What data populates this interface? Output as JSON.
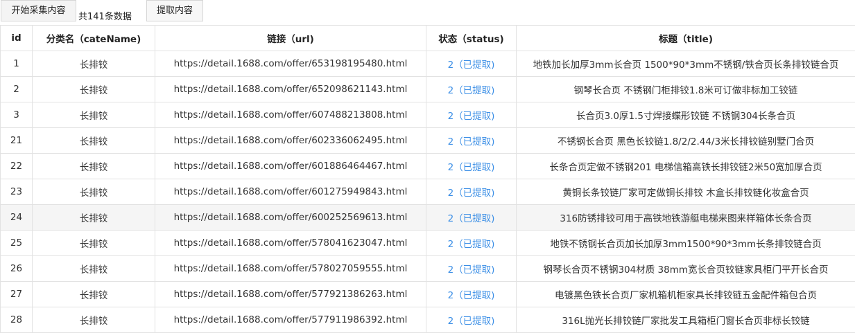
{
  "toolbar": {
    "start_label": "开始采集内容",
    "count_text": "共141条数据",
    "extract_label": "提取内容"
  },
  "table": {
    "headers": [
      "id",
      "分类名（cateName)",
      "链接（url)",
      "状态（status)",
      "标题（title)"
    ],
    "rows": [
      {
        "id": "1",
        "cate": "长排铰",
        "url": "https://detail.1688.com/offer/653198195480.html",
        "status": "2（已提取)",
        "title": "地铁加长加厚3mm长合页 1500*90*3mm不锈钢/铁合页长条排铰链合页"
      },
      {
        "id": "2",
        "cate": "长排铰",
        "url": "https://detail.1688.com/offer/652098621143.html",
        "status": "2（已提取)",
        "title": "钢琴长合页 不锈钢门柜排铰1.8米可订做非标加工铰链"
      },
      {
        "id": "3",
        "cate": "长排铰",
        "url": "https://detail.1688.com/offer/607488213808.html",
        "status": "2（已提取)",
        "title": "长合页3.0厚1.5寸焊接蝶形铰链 不锈钢304长条合页"
      },
      {
        "id": "21",
        "cate": "长排铰",
        "url": "https://detail.1688.com/offer/602336062495.html",
        "status": "2（已提取)",
        "title": "不锈钢长合页 黑色长铰链1.8/2/2.44/3米长排铰链别墅门合页"
      },
      {
        "id": "22",
        "cate": "长排铰",
        "url": "https://detail.1688.com/offer/601886464467.html",
        "status": "2（已提取)",
        "title": "长条合页定做不锈钢201 电梯信箱高铁长排铰链2米50宽加厚合页"
      },
      {
        "id": "23",
        "cate": "长排铰",
        "url": "https://detail.1688.com/offer/601275949843.html",
        "status": "2（已提取)",
        "title": "黄铜长条铰链厂家可定做铜长排铰 木盒长排铰链化妆盒合页"
      },
      {
        "id": "24",
        "cate": "长排铰",
        "url": "https://detail.1688.com/offer/600252569613.html",
        "status": "2（已提取)",
        "title": "316防锈排铰可用于高铁地铁游艇电梯来图来样箱体长条合页"
      },
      {
        "id": "25",
        "cate": "长排铰",
        "url": "https://detail.1688.com/offer/578041623047.html",
        "status": "2（已提取)",
        "title": "地铁不锈钢长合页加长加厚3mm1500*90*3mm长条排铰链合页"
      },
      {
        "id": "26",
        "cate": "长排铰",
        "url": "https://detail.1688.com/offer/578027059555.html",
        "status": "2（已提取)",
        "title": "钢琴长合页不锈钢304材质 38mm宽长合页铰链家具柜门平开长合页"
      },
      {
        "id": "27",
        "cate": "长排铰",
        "url": "https://detail.1688.com/offer/577921386263.html",
        "status": "2（已提取)",
        "title": "电镀黑色铁长合页厂家机箱机柜家具长排铰链五金配件箱包合页"
      },
      {
        "id": "28",
        "cate": "长排铰",
        "url": "https://detail.1688.com/offer/577911986392.html",
        "status": "2（已提取)",
        "title": "316L抛光长排铰链厂家批发工具箱柜门窗长合页非标长铰链"
      }
    ]
  }
}
